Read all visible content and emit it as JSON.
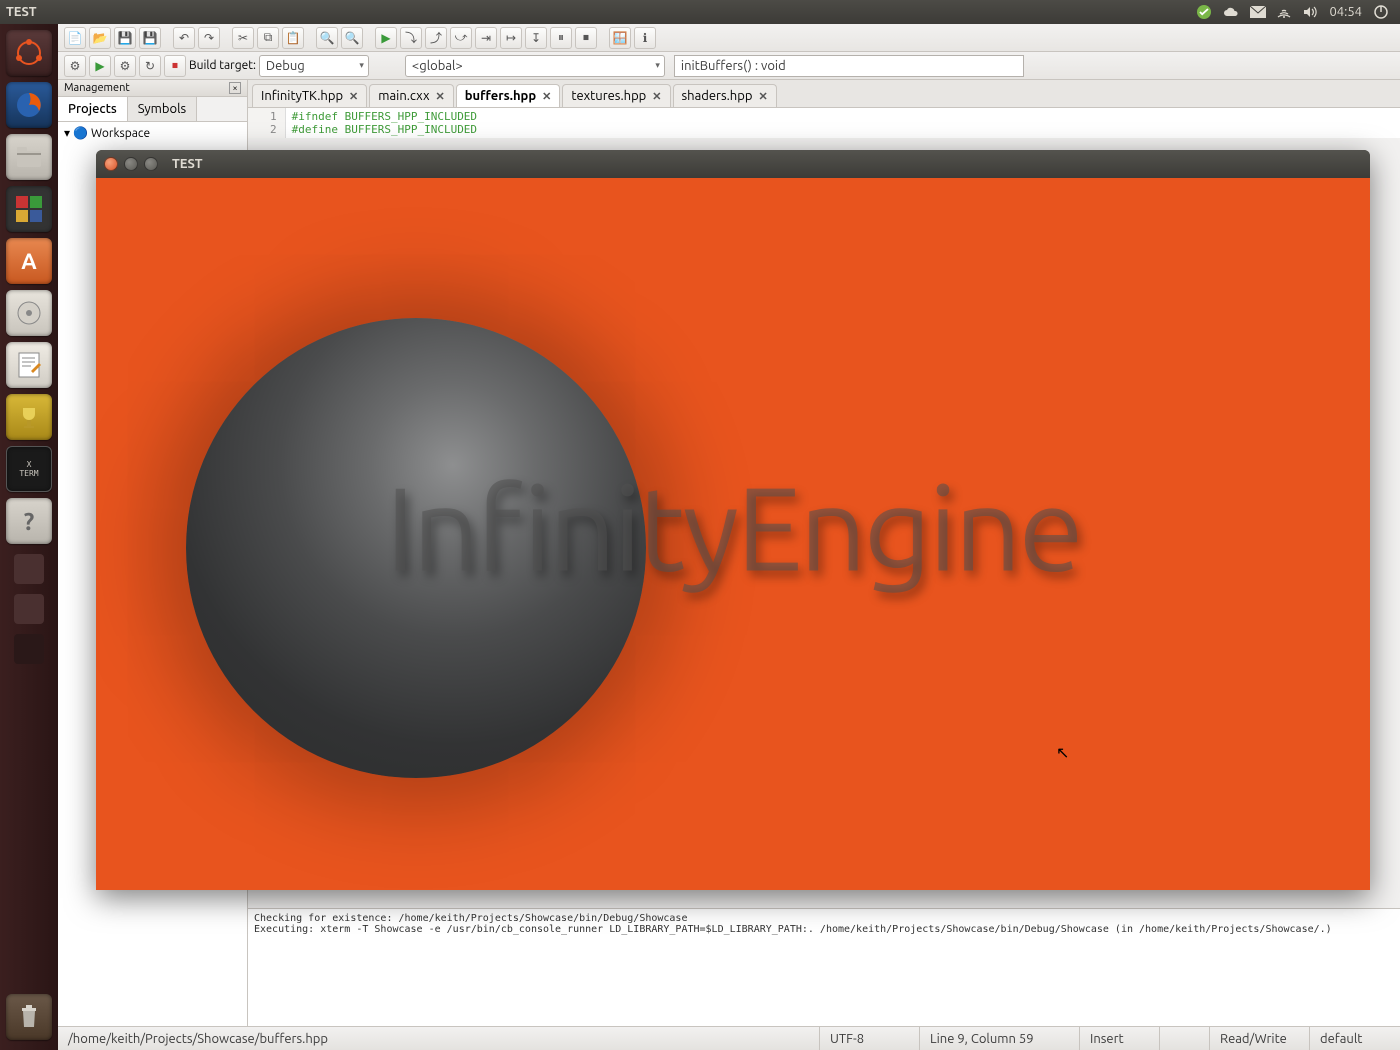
{
  "top_panel": {
    "title": "TEST",
    "clock": "04:54"
  },
  "toolbar1": {
    "build_target_label": "Build target:",
    "build_target_value": "Debug",
    "scope_value": "<global>",
    "function_value": "initBuffers() : void"
  },
  "management": {
    "title": "Management",
    "tabs": {
      "projects": "Projects",
      "symbols": "Symbols"
    },
    "tree_root": "Workspace"
  },
  "tabs": [
    {
      "label": "InfinityTK.hpp"
    },
    {
      "label": "main.cxx"
    },
    {
      "label": "buffers.hpp"
    },
    {
      "label": "textures.hpp"
    },
    {
      "label": "shaders.hpp"
    }
  ],
  "active_tab": "buffers.hpp",
  "code": {
    "line1_num": "1",
    "line1": "#ifndef BUFFERS_HPP_INCLUDED",
    "line2_num": "2",
    "line2": "#define BUFFERS_HPP_INCLUDED"
  },
  "log": {
    "line1": "Checking for existence: /home/keith/Projects/Showcase/bin/Debug/Showcase",
    "line2": "Executing: xterm -T Showcase -e /usr/bin/cb_console_runner LD_LIBRARY_PATH=$LD_LIBRARY_PATH:. /home/keith/Projects/Showcase/bin/Debug/Showcase  (in /home/keith/Projects/Showcase/.)"
  },
  "statusbar": {
    "path": "/home/keith/Projects/Showcase/buffers.hpp",
    "encoding": "UTF-8",
    "linecol": "Line 9, Column 59",
    "mode": "Insert",
    "rw": "Read/Write",
    "profile": "default"
  },
  "test_window": {
    "title": "TEST",
    "logo_text": "InfinityEngine",
    "bg_color": "#e8541e"
  }
}
